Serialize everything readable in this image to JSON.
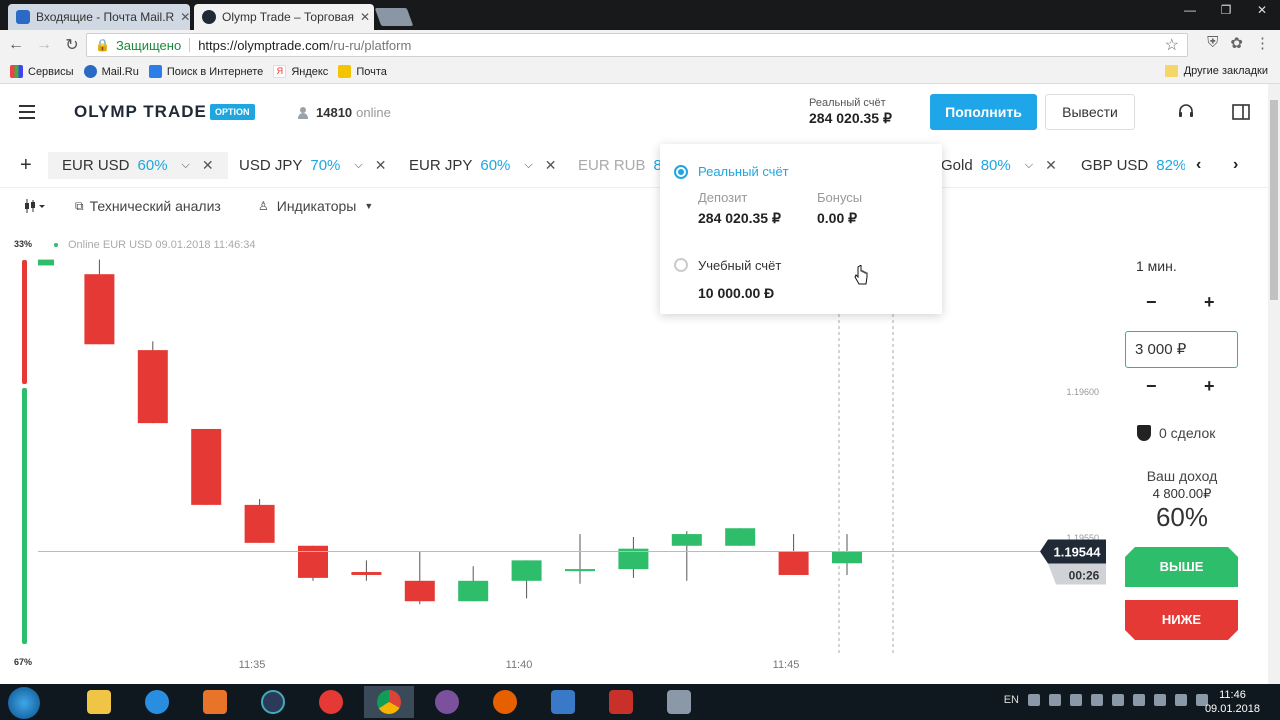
{
  "browser": {
    "tabs": [
      {
        "title": "Входящие - Почта Mail.R",
        "close": "✕"
      },
      {
        "title": "Olymp Trade – Торговая",
        "close": "✕"
      }
    ],
    "secure_label": "Защищено",
    "url_host": "https://olymptrade.com",
    "url_path": "/ru-ru/platform",
    "bookmarks": [
      "Сервисы",
      "Mail.Ru",
      "Поиск в Интернете",
      "Яндекс",
      "Почта"
    ],
    "other_bookmarks": "Другие закладки"
  },
  "header": {
    "logo": "OLYMP TRADE",
    "logo_badge": "OPTION",
    "online_count": "14810",
    "online_label": "online",
    "account_label": "Реальный счёт",
    "account_balance": "284 020.35 ₽",
    "deposit_label": "Пополнить",
    "withdraw_label": "Вывести"
  },
  "assets": {
    "add": "+",
    "items": [
      {
        "name": "EUR USD",
        "pct": "60%"
      },
      {
        "name": "USD JPY",
        "pct": "70%"
      },
      {
        "name": "EUR JPY",
        "pct": "60%"
      },
      {
        "name": "EUR RUB",
        "pct": "8"
      },
      {
        "name": "Gold",
        "pct": "80%"
      },
      {
        "name": "GBP USD",
        "pct": "82%"
      }
    ]
  },
  "tools": {
    "technical": "Технический анализ",
    "indicators": "Индикаторы"
  },
  "chart_data": {
    "type": "candlestick",
    "info": "Online EUR USD 09.01.2018 11:46:34",
    "top_pct": "33%",
    "bottom_pct": "67%",
    "x_ticks": [
      "11:35",
      "11:40",
      "11:45"
    ],
    "y_ticks": [
      "1.19600",
      "1.19550"
    ],
    "current_price": "1.19544",
    "countdown": "00:26",
    "candles": [
      {
        "dir": "up",
        "open": 1.19645,
        "close": 1.19643,
        "high": 1.19645,
        "low": 1.19643
      },
      {
        "dir": "down",
        "open": 1.1964,
        "close": 1.19616,
        "high": 1.19645,
        "low": 1.19616
      },
      {
        "dir": "down",
        "open": 1.19614,
        "close": 1.19589,
        "high": 1.19617,
        "low": 1.19589
      },
      {
        "dir": "down",
        "open": 1.19587,
        "close": 1.19561,
        "high": 1.19587,
        "low": 1.19561
      },
      {
        "dir": "down",
        "open": 1.19561,
        "close": 1.19548,
        "high": 1.19563,
        "low": 1.19548
      },
      {
        "dir": "down",
        "open": 1.19547,
        "close": 1.19536,
        "high": 1.19547,
        "low": 1.19535
      },
      {
        "dir": "down",
        "open": 1.19538,
        "close": 1.19537,
        "high": 1.19542,
        "low": 1.19535
      },
      {
        "dir": "down",
        "open": 1.19535,
        "close": 1.19528,
        "high": 1.19545,
        "low": 1.19527
      },
      {
        "dir": "up",
        "open": 1.19528,
        "close": 1.19535,
        "high": 1.1954,
        "low": 1.19528
      },
      {
        "dir": "up",
        "open": 1.19535,
        "close": 1.19542,
        "high": 1.19542,
        "low": 1.19529
      },
      {
        "dir": "up",
        "open": 1.19539,
        "close": 1.19539,
        "high": 1.19551,
        "low": 1.19534
      },
      {
        "dir": "up",
        "open": 1.19539,
        "close": 1.19546,
        "high": 1.1955,
        "low": 1.19536
      },
      {
        "dir": "up",
        "open": 1.19547,
        "close": 1.19551,
        "high": 1.19552,
        "low": 1.19535
      },
      {
        "dir": "up",
        "open": 1.19547,
        "close": 1.19553,
        "high": 1.19553,
        "low": 1.19547
      },
      {
        "dir": "down",
        "open": 1.19545,
        "close": 1.19537,
        "high": 1.19551,
        "low": 1.19537
      },
      {
        "dir": "up",
        "open": 1.19541,
        "close": 1.19545,
        "high": 1.19551,
        "low": 1.19537
      }
    ]
  },
  "panel": {
    "time": "1 мин.",
    "minus": "−",
    "plus": "+",
    "amount": "3 000 ₽",
    "deals": "0 сделок",
    "income_label": "Ваш доход",
    "income_value": "4 800.00₽",
    "income_pct": "60%",
    "up_label": "ВЫШЕ",
    "down_label": "НИЖЕ"
  },
  "popup": {
    "real_title": "Реальный счёт",
    "deposit_label": "Депозит",
    "deposit_value": "284 020.35 ₽",
    "bonus_label": "Бонусы",
    "bonus_value": "0.00 ₽",
    "demo_title": "Учебный счёт",
    "demo_value": "10 000.00 Ð"
  },
  "taskbar": {
    "lang": "EN",
    "time": "11:46",
    "date": "09.01.2018"
  }
}
